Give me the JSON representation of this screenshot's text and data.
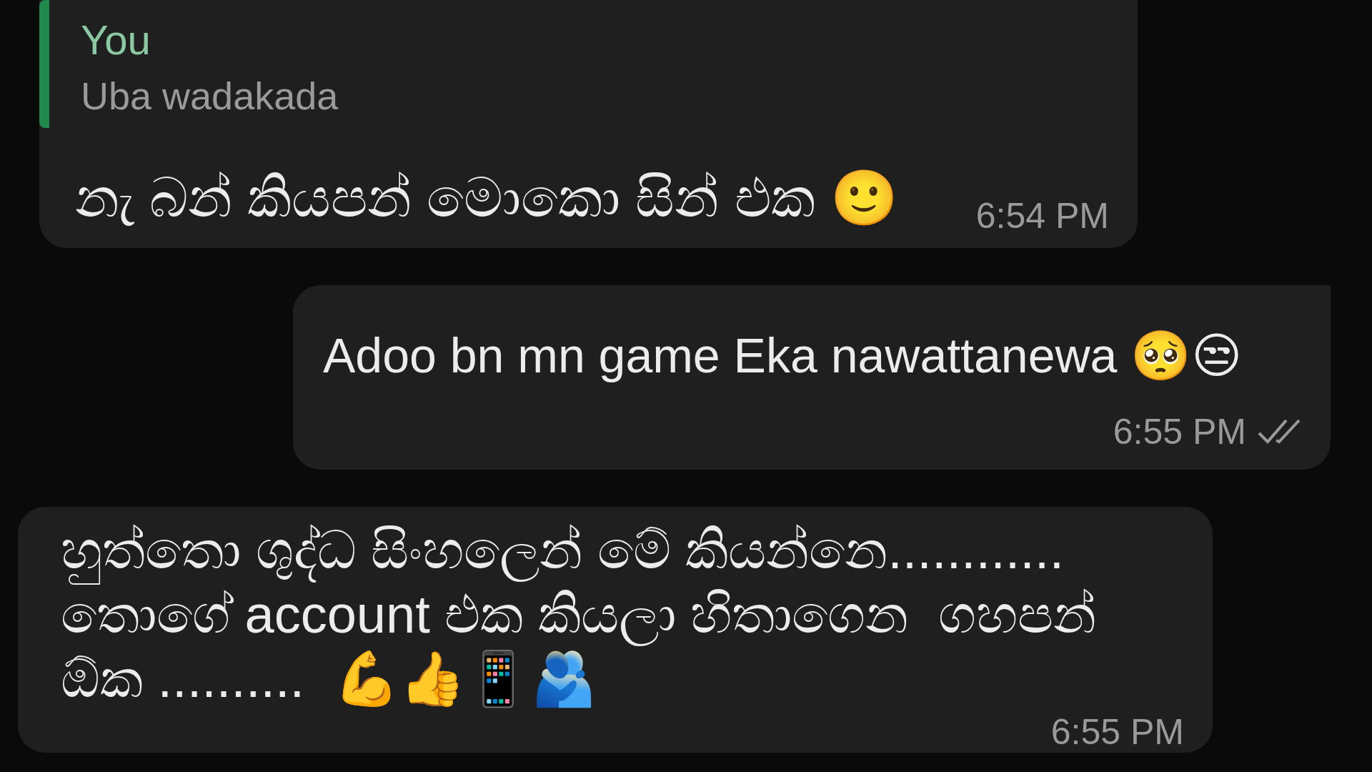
{
  "messages": [
    {
      "kind": "incoming",
      "quote": {
        "author": "You",
        "text": "Uba wadakada"
      },
      "lines": [
        "නැ බන් කියපන් මොකො සින් එක 🙂"
      ],
      "time": "6:54 PM"
    },
    {
      "kind": "outgoing",
      "lines": [
        "Adoo bn mn game Eka nawattanewa 🥺😒"
      ],
      "time": "6:55 PM",
      "read": false
    },
    {
      "kind": "incoming",
      "lines": [
        "හුත්තො ශුද්ධ සිංහලෙන් මේ කියන්නෙ............",
        "තොගේ account එක කියලා හිතාගෙන  ගහපන්",
        "ඕක ..........  💪👍📱🫂"
      ],
      "time": "6:55 PM"
    }
  ]
}
